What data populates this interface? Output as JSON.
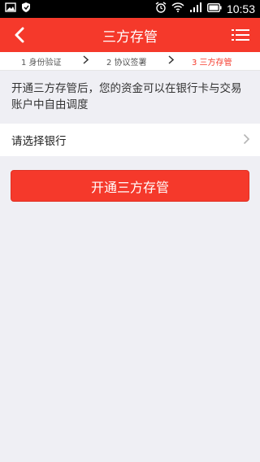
{
  "statusbar": {
    "time": "10:53"
  },
  "header": {
    "title": "三方存管"
  },
  "steps": [
    {
      "label": "1 身份验证"
    },
    {
      "label": "2 协议签署"
    },
    {
      "label": "3 三方存管"
    }
  ],
  "info": {
    "text": "开通三方存管后，您的资金可以在银行卡与交易账户中自由调度"
  },
  "bank": {
    "label": "请选择银行"
  },
  "action": {
    "label": "开通三方存管"
  },
  "colors": {
    "accent": "#f5392b",
    "background": "#efeff4"
  }
}
